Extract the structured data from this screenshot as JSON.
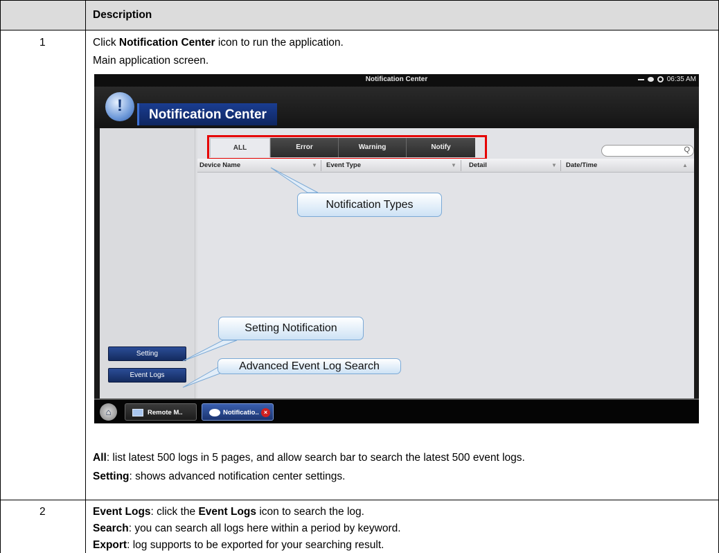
{
  "table": {
    "header": {
      "num_col": "",
      "desc_col": "Description"
    },
    "row1": {
      "num": "1",
      "line1_bold": "Notification Center",
      "line1_pre": "Click ",
      "line1_post": " icon to run the application.",
      "line2": "Main application screen.",
      "all_label": "All",
      "all_text": ": list latest 500 logs in 5 pages, and allow search bar to search the latest 500 event logs.",
      "setting_label": "Setting",
      "setting_text": ": shows advanced notification center settings."
    },
    "row2": {
      "num": "2",
      "eventlogs_label": "Event Logs",
      "eventlogs_mid": ": click the ",
      "eventlogs_bold2": "Event Logs",
      "eventlogs_post": " icon to search the log.",
      "search_label": "Search",
      "search_text": ": you can search all logs here within a period by keyword.",
      "export_label": "Export",
      "export_text": ": log supports to be exported for your searching result."
    }
  },
  "screenshot": {
    "window_title": "Notification Center",
    "clock": "06:35 AM",
    "app_logo_glyph": "!",
    "app_title": "Notification Center",
    "tabs": [
      "ALL",
      "Error",
      "Warning",
      "Notify"
    ],
    "active_tab": "ALL",
    "search_icon": "magnifier-icon",
    "search_glyph": "Q",
    "columns": [
      "Device Name",
      "Event Type",
      "Detail",
      "Date/Time"
    ],
    "sort_glyphs": {
      "down": "▼",
      "up": "▲"
    },
    "callouts": {
      "notification_types": "Notification Types",
      "setting_notification": "Setting Notification",
      "advanced_search": "Advanced Event Log Search"
    },
    "buttons": {
      "setting": "Setting",
      "event_logs": "Event Logs"
    },
    "taskbar": {
      "home_glyph": "⌂",
      "remote": "Remote M..",
      "notification": "Notificatio..",
      "close_glyph": "×"
    },
    "highlight_color": "#e60000"
  }
}
